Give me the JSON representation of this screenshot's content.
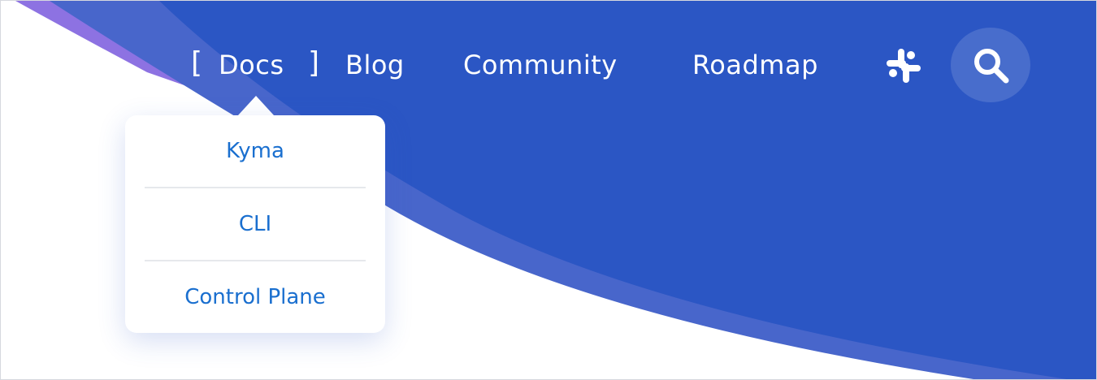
{
  "nav": {
    "items": [
      {
        "label": "Docs",
        "active": true
      },
      {
        "label": "Blog"
      },
      {
        "label": "Community"
      },
      {
        "label": "Roadmap"
      }
    ],
    "active_bracket_left": "[",
    "active_bracket_right": "]",
    "icons": {
      "slack": "slack-icon",
      "search": "search-icon"
    }
  },
  "dropdown": {
    "items": [
      "Kyma",
      "CLI",
      "Control Plane"
    ]
  },
  "colors": {
    "primary_blue": "#2b56c4",
    "mid_blue": "#4866cb",
    "violet": "#8d72e2",
    "link_blue": "#1a6fcf",
    "text_white": "#ffffff"
  }
}
